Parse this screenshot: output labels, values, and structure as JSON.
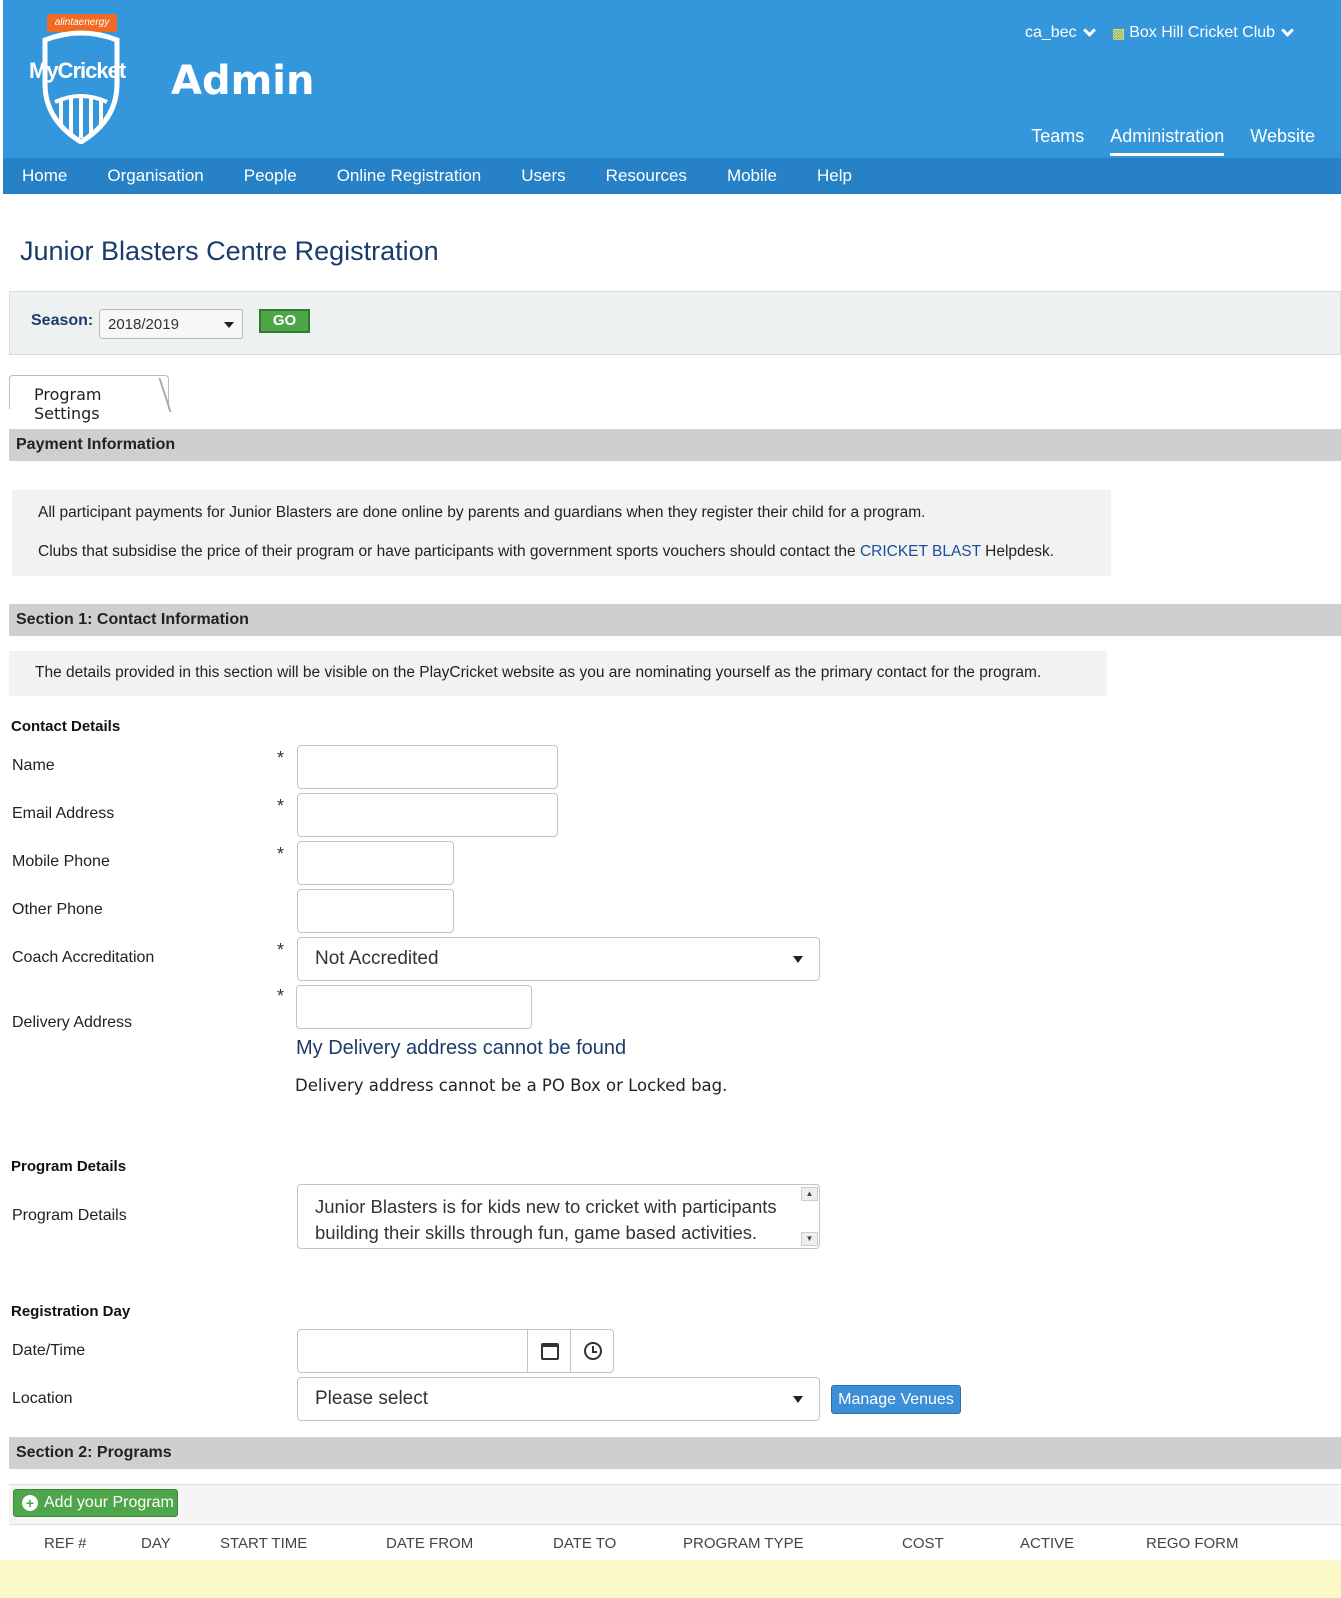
{
  "header": {
    "brand_badge": "alintaenergy",
    "logo_text": "MyCricket",
    "title": "Admin",
    "user": "ca_bec",
    "club": "Box Hill Cricket Club",
    "tabs": [
      "Teams",
      "Administration",
      "Website"
    ],
    "active_tab": "Administration"
  },
  "nav": [
    "Home",
    "Organisation",
    "People",
    "Online Registration",
    "Users",
    "Resources",
    "Mobile",
    "Help"
  ],
  "page_title": "Junior Blasters Centre Registration",
  "season": {
    "label": "Season:",
    "value": "2018/2019",
    "go_label": "GO"
  },
  "tab_label": "Program Settings",
  "payment": {
    "heading": "Payment Information",
    "line1": "All participant payments for Junior Blasters are done online by parents and guardians when they register their child for a program.",
    "line2_pre": "Clubs that subsidise the price of their program or have participants with government sports vouchers should contact the ",
    "line2_link": "CRICKET BLAST",
    "line2_post": " Helpdesk."
  },
  "section1": {
    "heading": "Section 1: Contact Information",
    "note": "The details provided in this section will be visible on the PlayCricket website as you are nominating yourself as the primary contact for the program.",
    "contact_group": "Contact Details",
    "fields": {
      "name": "Name",
      "email": "Email Address",
      "mobile": "Mobile Phone",
      "other": "Other Phone",
      "coach": "Coach Accreditation",
      "delivery": "Delivery Address"
    },
    "coach_value": "Not Accredited",
    "required_mark": "*",
    "delivery_link": "My Delivery address cannot be found",
    "delivery_note": "Delivery address cannot be a PO Box or Locked bag.",
    "program_group": "Program Details",
    "program_label": "Program Details",
    "program_text": "Junior Blasters is for kids new to cricket with participants building their skills through fun, game based activities.",
    "registration_group": "Registration Day",
    "datetime_label": "Date/Time",
    "location_label": "Location",
    "location_value": "Please select",
    "manage_venues": "Manage Venues"
  },
  "section2": {
    "heading": "Section 2: Programs",
    "add_label": "Add your Program",
    "columns": [
      "REF #",
      "DAY",
      "START TIME",
      "DATE FROM",
      "DATE TO",
      "PROGRAM TYPE",
      "COST",
      "ACTIVE",
      "REGO FORM"
    ]
  }
}
